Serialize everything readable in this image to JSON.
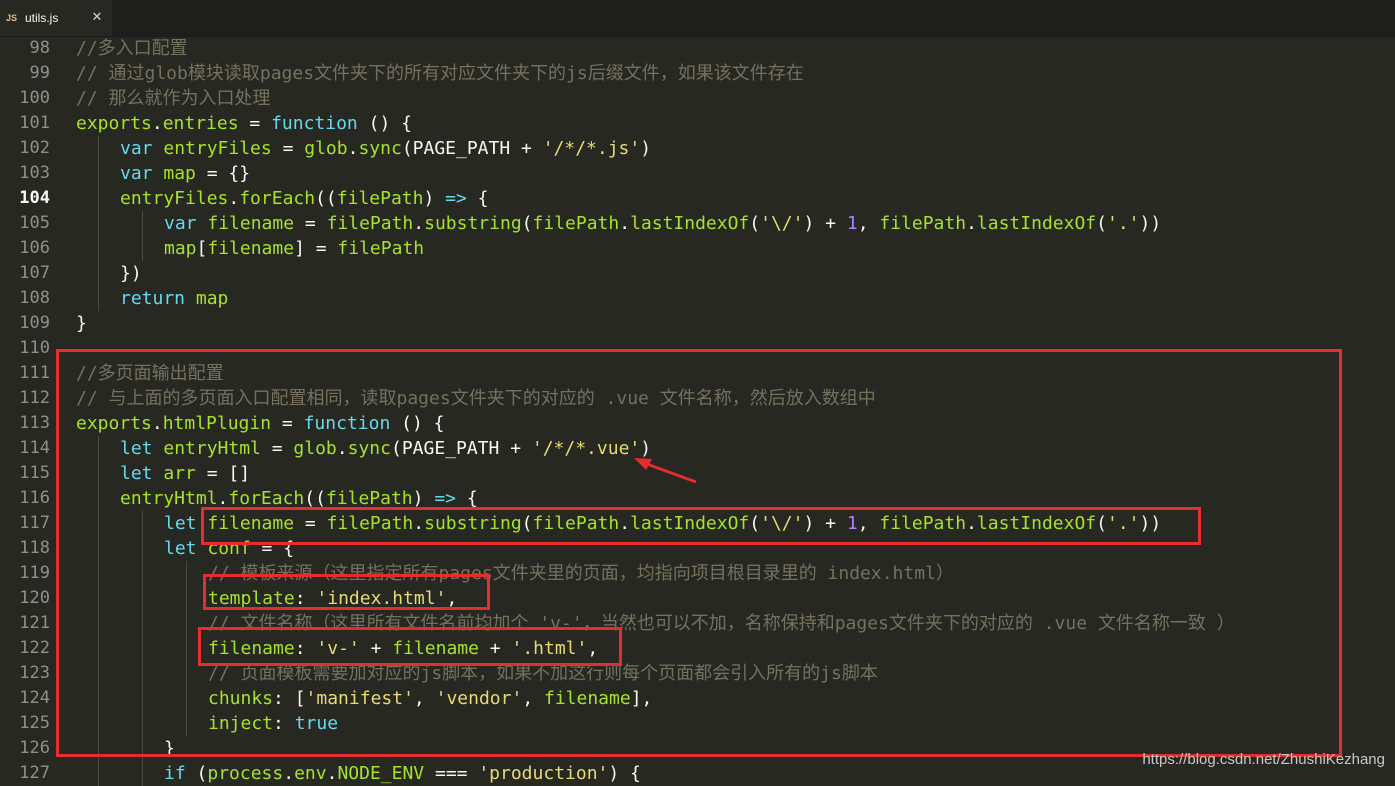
{
  "tab": {
    "icon_text": "JS",
    "filename": "utils.js",
    "close_glyph": "✕"
  },
  "watermark": "https://blog.csdn.net/ZhushiKezhang",
  "lines": [
    {
      "num": "98",
      "indent": 0,
      "tokens": [
        [
          "c",
          "//多入口配置"
        ]
      ]
    },
    {
      "num": "99",
      "indent": 0,
      "tokens": [
        [
          "c",
          "// 通过glob模块读取pages文件夹下的所有对应文件夹下的js后缀文件，如果该文件存在"
        ]
      ]
    },
    {
      "num": "100",
      "indent": 0,
      "tokens": [
        [
          "c",
          "// 那么就作为入口处理"
        ]
      ]
    },
    {
      "num": "101",
      "indent": 0,
      "tokens": [
        [
          "f",
          "exports"
        ],
        [
          "p",
          "."
        ],
        [
          "f",
          "entries"
        ],
        [
          "p",
          " = "
        ],
        [
          "k",
          "function"
        ],
        [
          "p",
          " () {"
        ]
      ]
    },
    {
      "num": "102",
      "indent": 1,
      "tokens": [
        [
          "k",
          "var"
        ],
        [
          "p",
          " "
        ],
        [
          "f",
          "entryFiles"
        ],
        [
          "p",
          " = "
        ],
        [
          "f",
          "glob"
        ],
        [
          "p",
          "."
        ],
        [
          "f",
          "sync"
        ],
        [
          "p",
          "(PAGE_PATH + "
        ],
        [
          "s",
          "'/*/*.js'"
        ],
        [
          "p",
          ")"
        ]
      ]
    },
    {
      "num": "103",
      "indent": 1,
      "tokens": [
        [
          "k",
          "var"
        ],
        [
          "p",
          " "
        ],
        [
          "f",
          "map"
        ],
        [
          "p",
          " = {}"
        ]
      ]
    },
    {
      "num": "104",
      "indent": 1,
      "tokens": [
        [
          "f",
          "entryFiles"
        ],
        [
          "p",
          "."
        ],
        [
          "f",
          "forEach"
        ],
        [
          "p",
          "(("
        ],
        [
          "f",
          "filePath"
        ],
        [
          "p",
          ") "
        ],
        [
          "k",
          "=>"
        ],
        [
          "p",
          " {"
        ]
      ],
      "active": true
    },
    {
      "num": "105",
      "indent": 2,
      "tokens": [
        [
          "k",
          "var"
        ],
        [
          "p",
          " "
        ],
        [
          "f",
          "filename"
        ],
        [
          "p",
          " = "
        ],
        [
          "f",
          "filePath"
        ],
        [
          "p",
          "."
        ],
        [
          "f",
          "substring"
        ],
        [
          "p",
          "("
        ],
        [
          "f",
          "filePath"
        ],
        [
          "p",
          "."
        ],
        [
          "f",
          "lastIndexOf"
        ],
        [
          "p",
          "("
        ],
        [
          "s",
          "'\\/'"
        ],
        [
          "p",
          ") + "
        ],
        [
          "n",
          "1"
        ],
        [
          "p",
          ", "
        ],
        [
          "f",
          "filePath"
        ],
        [
          "p",
          "."
        ],
        [
          "f",
          "lastIndexOf"
        ],
        [
          "p",
          "("
        ],
        [
          "s",
          "'.'"
        ],
        [
          "p",
          "))"
        ]
      ]
    },
    {
      "num": "106",
      "indent": 2,
      "tokens": [
        [
          "f",
          "map"
        ],
        [
          "p",
          "["
        ],
        [
          "f",
          "filename"
        ],
        [
          "p",
          "] = "
        ],
        [
          "f",
          "filePath"
        ]
      ]
    },
    {
      "num": "107",
      "indent": 1,
      "tokens": [
        [
          "p",
          "})"
        ]
      ]
    },
    {
      "num": "108",
      "indent": 1,
      "tokens": [
        [
          "k",
          "return"
        ],
        [
          "p",
          " "
        ],
        [
          "f",
          "map"
        ]
      ]
    },
    {
      "num": "109",
      "indent": 0,
      "tokens": [
        [
          "p",
          "}"
        ]
      ]
    },
    {
      "num": "110",
      "indent": 0,
      "tokens": []
    },
    {
      "num": "111",
      "indent": 0,
      "tokens": [
        [
          "c",
          "//多页面输出配置"
        ]
      ]
    },
    {
      "num": "112",
      "indent": 0,
      "tokens": [
        [
          "c",
          "// 与上面的多页面入口配置相同，读取pages文件夹下的对应的 .vue 文件名称，然后放入数组中"
        ]
      ]
    },
    {
      "num": "113",
      "indent": 0,
      "tokens": [
        [
          "f",
          "exports"
        ],
        [
          "p",
          "."
        ],
        [
          "f",
          "htmlPlugin"
        ],
        [
          "p",
          " = "
        ],
        [
          "k",
          "function"
        ],
        [
          "p",
          " () {"
        ]
      ]
    },
    {
      "num": "114",
      "indent": 1,
      "tokens": [
        [
          "k",
          "let"
        ],
        [
          "p",
          " "
        ],
        [
          "f",
          "entryHtml"
        ],
        [
          "p",
          " = "
        ],
        [
          "f",
          "glob"
        ],
        [
          "p",
          "."
        ],
        [
          "f",
          "sync"
        ],
        [
          "p",
          "(PAGE_PATH + "
        ],
        [
          "s",
          "'/*/*.vue'"
        ],
        [
          "p",
          ")"
        ]
      ]
    },
    {
      "num": "115",
      "indent": 1,
      "tokens": [
        [
          "k",
          "let"
        ],
        [
          "p",
          " "
        ],
        [
          "f",
          "arr"
        ],
        [
          "p",
          " = []"
        ]
      ]
    },
    {
      "num": "116",
      "indent": 1,
      "tokens": [
        [
          "f",
          "entryHtml"
        ],
        [
          "p",
          "."
        ],
        [
          "f",
          "forEach"
        ],
        [
          "p",
          "(("
        ],
        [
          "f",
          "filePath"
        ],
        [
          "p",
          ") "
        ],
        [
          "k",
          "=>"
        ],
        [
          "p",
          " {"
        ]
      ]
    },
    {
      "num": "117",
      "indent": 2,
      "tokens": [
        [
          "k",
          "let"
        ],
        [
          "p",
          " "
        ],
        [
          "f",
          "filename"
        ],
        [
          "p",
          " = "
        ],
        [
          "f",
          "filePath"
        ],
        [
          "p",
          "."
        ],
        [
          "f",
          "substring"
        ],
        [
          "p",
          "("
        ],
        [
          "f",
          "filePath"
        ],
        [
          "p",
          "."
        ],
        [
          "f",
          "lastIndexOf"
        ],
        [
          "p",
          "("
        ],
        [
          "s",
          "'\\/'"
        ],
        [
          "p",
          ") + "
        ],
        [
          "n",
          "1"
        ],
        [
          "p",
          ", "
        ],
        [
          "f",
          "filePath"
        ],
        [
          "p",
          "."
        ],
        [
          "f",
          "lastIndexOf"
        ],
        [
          "p",
          "("
        ],
        [
          "s",
          "'.'"
        ],
        [
          "p",
          "))"
        ]
      ]
    },
    {
      "num": "118",
      "indent": 2,
      "tokens": [
        [
          "k",
          "let"
        ],
        [
          "p",
          " "
        ],
        [
          "f",
          "conf"
        ],
        [
          "p",
          " = {"
        ]
      ]
    },
    {
      "num": "119",
      "indent": 3,
      "tokens": [
        [
          "c",
          "// 模板来源（这里指定所有pages文件夹里的页面，均指向项目根目录里的 index.html）"
        ]
      ]
    },
    {
      "num": "120",
      "indent": 3,
      "tokens": [
        [
          "f",
          "template"
        ],
        [
          "p",
          ": "
        ],
        [
          "s",
          "'index.html'"
        ],
        [
          "p",
          ","
        ]
      ]
    },
    {
      "num": "121",
      "indent": 3,
      "tokens": [
        [
          "c",
          "// 文件名称（这里所有文件名前均加个 'v-'，当然也可以不加，名称保持和pages文件夹下的对应的 .vue 文件名称一致 ）"
        ]
      ]
    },
    {
      "num": "122",
      "indent": 3,
      "tokens": [
        [
          "f",
          "filename"
        ],
        [
          "p",
          ": "
        ],
        [
          "s",
          "'v-'"
        ],
        [
          "p",
          " + "
        ],
        [
          "f",
          "filename"
        ],
        [
          "p",
          " + "
        ],
        [
          "s",
          "'.html'"
        ],
        [
          "p",
          ","
        ]
      ]
    },
    {
      "num": "123",
      "indent": 3,
      "tokens": [
        [
          "c",
          "// 页面模板需要加对应的js脚本，如果不加这行则每个页面都会引入所有的js脚本"
        ]
      ]
    },
    {
      "num": "124",
      "indent": 3,
      "tokens": [
        [
          "f",
          "chunks"
        ],
        [
          "p",
          ": ["
        ],
        [
          "s",
          "'manifest'"
        ],
        [
          "p",
          ", "
        ],
        [
          "s",
          "'vendor'"
        ],
        [
          "p",
          ", "
        ],
        [
          "f",
          "filename"
        ],
        [
          "p",
          "],"
        ]
      ]
    },
    {
      "num": "125",
      "indent": 3,
      "tokens": [
        [
          "f",
          "inject"
        ],
        [
          "p",
          ": "
        ],
        [
          "k",
          "true"
        ]
      ]
    },
    {
      "num": "126",
      "indent": 2,
      "tokens": [
        [
          "p",
          "}"
        ]
      ]
    },
    {
      "num": "127",
      "indent": 2,
      "tokens": [
        [
          "k",
          "if"
        ],
        [
          "p",
          " ("
        ],
        [
          "f",
          "process"
        ],
        [
          "p",
          "."
        ],
        [
          "f",
          "env"
        ],
        [
          "p",
          "."
        ],
        [
          "f",
          "NODE_ENV"
        ],
        [
          "p",
          " === "
        ],
        [
          "s",
          "'production'"
        ],
        [
          "p",
          ") {"
        ]
      ]
    }
  ]
}
